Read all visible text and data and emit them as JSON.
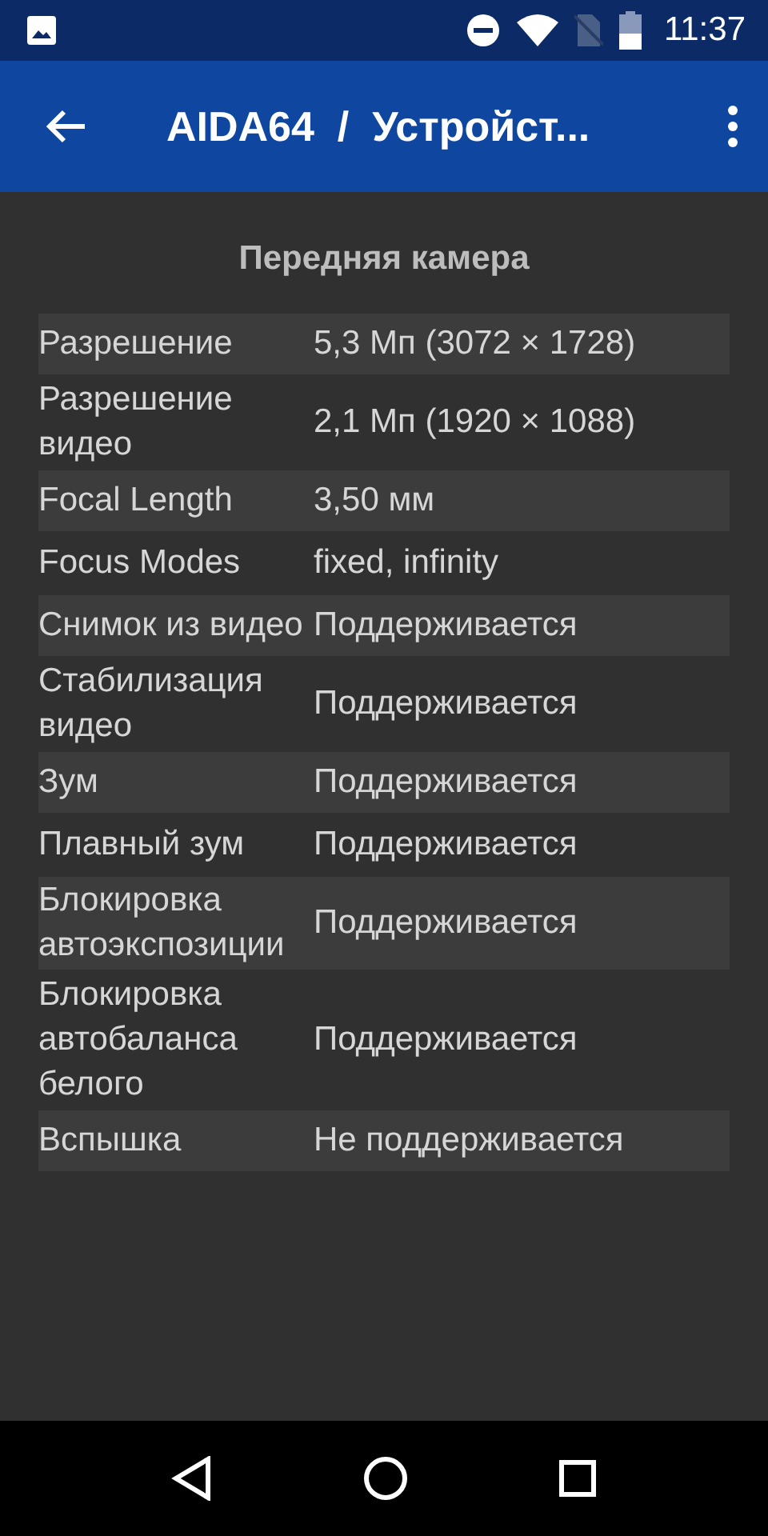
{
  "status_bar": {
    "time": "11:37"
  },
  "app_bar": {
    "title": "AIDA64  /  Устройст..."
  },
  "section": {
    "title": "Передняя камера"
  },
  "rows": [
    {
      "label": "Разрешение",
      "value": "5,3 Мп (3072 × 1728)"
    },
    {
      "label": "Разрешение видео",
      "value": "2,1 Мп (1920 × 1088)"
    },
    {
      "label": "Focal Length",
      "value": "3,50 мм"
    },
    {
      "label": "Focus Modes",
      "value": "fixed, infinity"
    },
    {
      "label": "Снимок из видео",
      "value": "Поддерживается"
    },
    {
      "label": "Стабилизация видео",
      "value": "Поддерживается"
    },
    {
      "label": "Зум",
      "value": "Поддерживается"
    },
    {
      "label": "Плавный зум",
      "value": "Поддерживается"
    },
    {
      "label": "Блокировка автоэкспозиции",
      "value": "Поддерживается"
    },
    {
      "label": "Блокировка автобаланса белого",
      "value": "Поддерживается"
    },
    {
      "label": "Вспышка",
      "value": "Не поддерживается"
    }
  ]
}
